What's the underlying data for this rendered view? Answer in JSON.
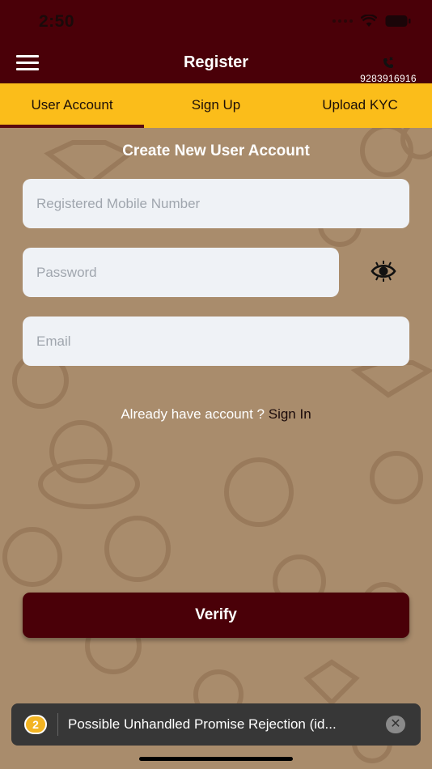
{
  "status_bar": {
    "time": "2:50",
    "wifi_icon": "wifi-icon",
    "battery_icon": "battery-icon"
  },
  "header": {
    "title": "Register",
    "menu_icon": "hamburger-menu-icon",
    "phone_icon": "phone-icon",
    "phone_number": "9283916916"
  },
  "tabs": [
    {
      "label": "User Account",
      "active": true
    },
    {
      "label": "Sign Up",
      "active": false
    },
    {
      "label": "Upload KYC",
      "active": false
    }
  ],
  "form": {
    "title": "Create New User Account",
    "mobile_placeholder": "Registered Mobile Number",
    "password_placeholder": "Password",
    "email_placeholder": "Email",
    "eye_icon": "eye-icon",
    "already_text": "Already have account ? ",
    "signin_label": "Sign In",
    "verify_label": "Verify"
  },
  "toast": {
    "count": "2",
    "message": "Possible Unhandled Promise Rejection (id..."
  },
  "colors": {
    "header_bg": "#4a0008",
    "tab_bg": "#fbbd1a",
    "tab_indicator": "#5a0a10",
    "page_bg": "#a98c6c",
    "verify_bg": "#4a0008"
  }
}
